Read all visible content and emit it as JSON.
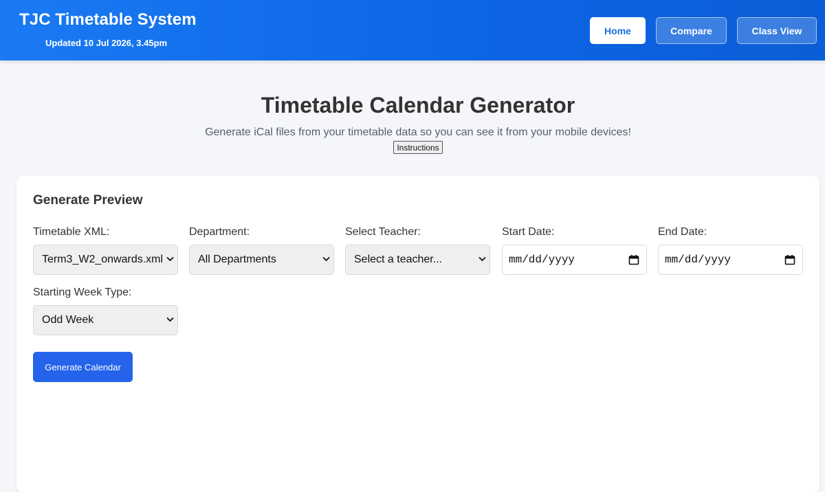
{
  "header": {
    "title": "TJC Timetable System",
    "updated": "Updated 10 Jul 2026, 3.45pm",
    "nav": [
      {
        "label": "Home"
      },
      {
        "label": "Compare"
      },
      {
        "label": "Class View"
      }
    ]
  },
  "hero": {
    "title": "Timetable Calendar Generator",
    "subtitle": "Generate iCal files from your timetable data so you can see it from your mobile devices!",
    "instructions_label": "Instructions"
  },
  "form": {
    "title": "Generate Preview",
    "fields": {
      "xml": {
        "label": "Timetable XML:",
        "value": "Term3_W2_onwards.xml"
      },
      "department": {
        "label": "Department:",
        "value": "All Departments"
      },
      "teacher": {
        "label": "Select Teacher:",
        "value": "Select a teacher..."
      },
      "start_date": {
        "label": "Start Date:",
        "value": "mm/dd/yyyy"
      },
      "end_date": {
        "label": "End Date:",
        "value": "mm/dd/yyyy"
      },
      "week_type": {
        "label": "Starting Week Type:",
        "value": "Odd Week"
      }
    },
    "generate_label": "Generate Calendar"
  },
  "colors": {
    "header_gradient_start": "#1a7af3",
    "header_gradient_end": "#0b5ed7",
    "primary_button": "#2563eb",
    "page_background": "#f5f6fa"
  }
}
